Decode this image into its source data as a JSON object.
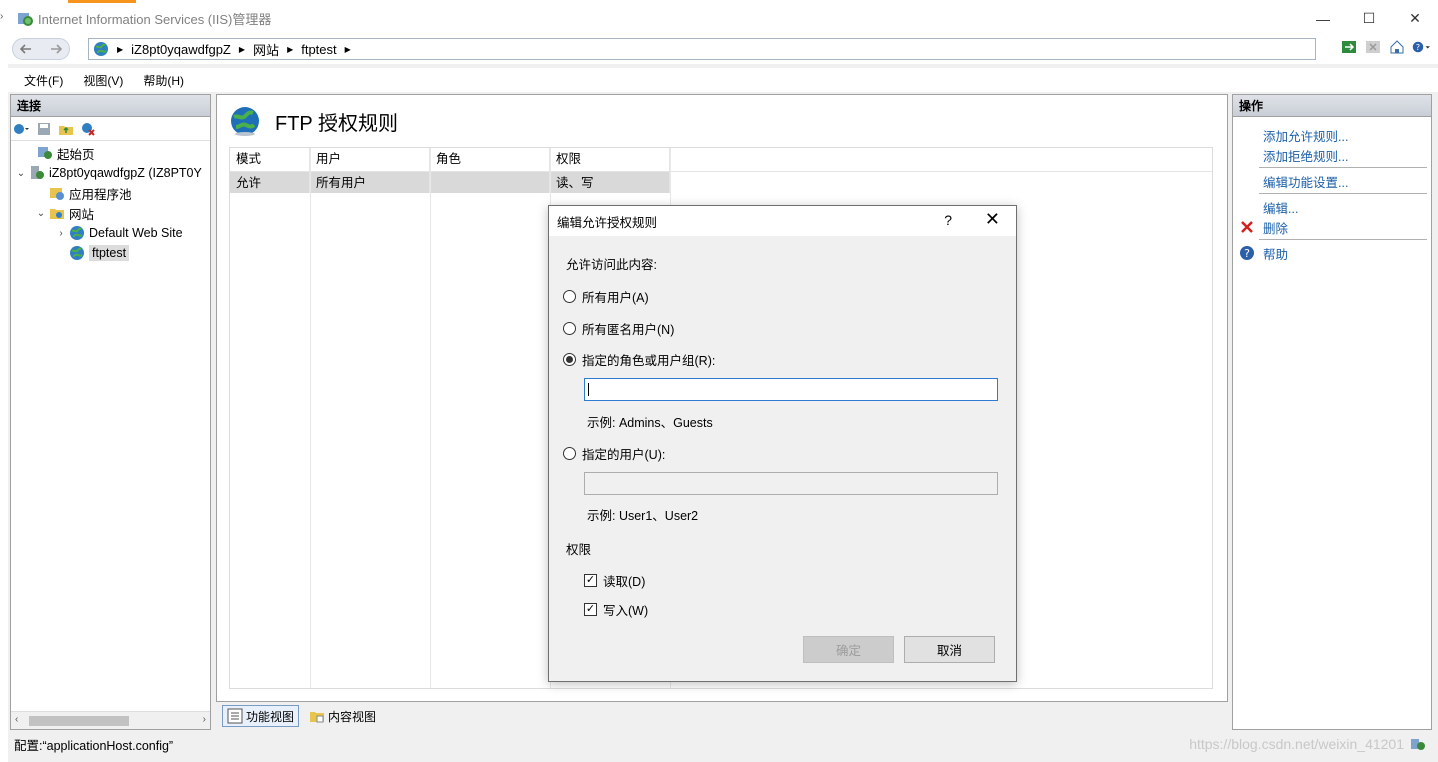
{
  "window": {
    "title": "Internet Information Services (IIS)管理器"
  },
  "address": {
    "segments": [
      "iZ8pt0yqawdfgpZ",
      "网站",
      "ftptest"
    ]
  },
  "menu": {
    "file": "文件(F)",
    "view": "视图(V)",
    "help": "帮助(H)"
  },
  "connections": {
    "header": "连接",
    "tree": {
      "start_page": "起始页",
      "server": "iZ8pt0yqawdfgpZ (IZ8PT0Y",
      "app_pools": "应用程序池",
      "sites": "网站",
      "default_site": "Default Web Site",
      "ftptest": "ftptest"
    }
  },
  "feature": {
    "title": "FTP 授权规则",
    "columns": [
      "模式",
      "用户",
      "角色",
      "权限"
    ],
    "rows": [
      {
        "mode": "允许",
        "users": "所有用户",
        "roles": "",
        "permissions": "读、写"
      }
    ]
  },
  "bottom_tabs": {
    "features_view": "功能视图",
    "content_view": "内容视图"
  },
  "actions": {
    "header": "操作",
    "add_allow": "添加允许规则...",
    "add_deny": "添加拒绝规则...",
    "edit_feature": "编辑功能设置...",
    "edit": "编辑...",
    "remove": "删除",
    "help": "帮助"
  },
  "status": {
    "text": "配置:“applicationHost.config”"
  },
  "watermark": "https://blog.csdn.net/weixin_41201",
  "dialog": {
    "title": "编辑允许授权规则",
    "help_glyph": "?",
    "close_glyph": "✕",
    "access_label": "允许访问此内容:",
    "opt_all_users": "所有用户(A)",
    "opt_anonymous": "所有匿名用户(N)",
    "opt_roles": "指定的角色或用户组(R):",
    "roles_value": "",
    "roles_example": "示例: Admins、Guests",
    "opt_users": "指定的用户(U):",
    "users_value": "",
    "users_example": "示例: User1、User2",
    "permissions_label": "权限",
    "read": "读取(D)",
    "write": "写入(W)",
    "ok": "确定",
    "cancel": "取消",
    "selected_option": "roles",
    "read_checked": true,
    "write_checked": true
  },
  "window_controls": {
    "minimize": "—",
    "maximize": "☐",
    "close": "✕"
  }
}
